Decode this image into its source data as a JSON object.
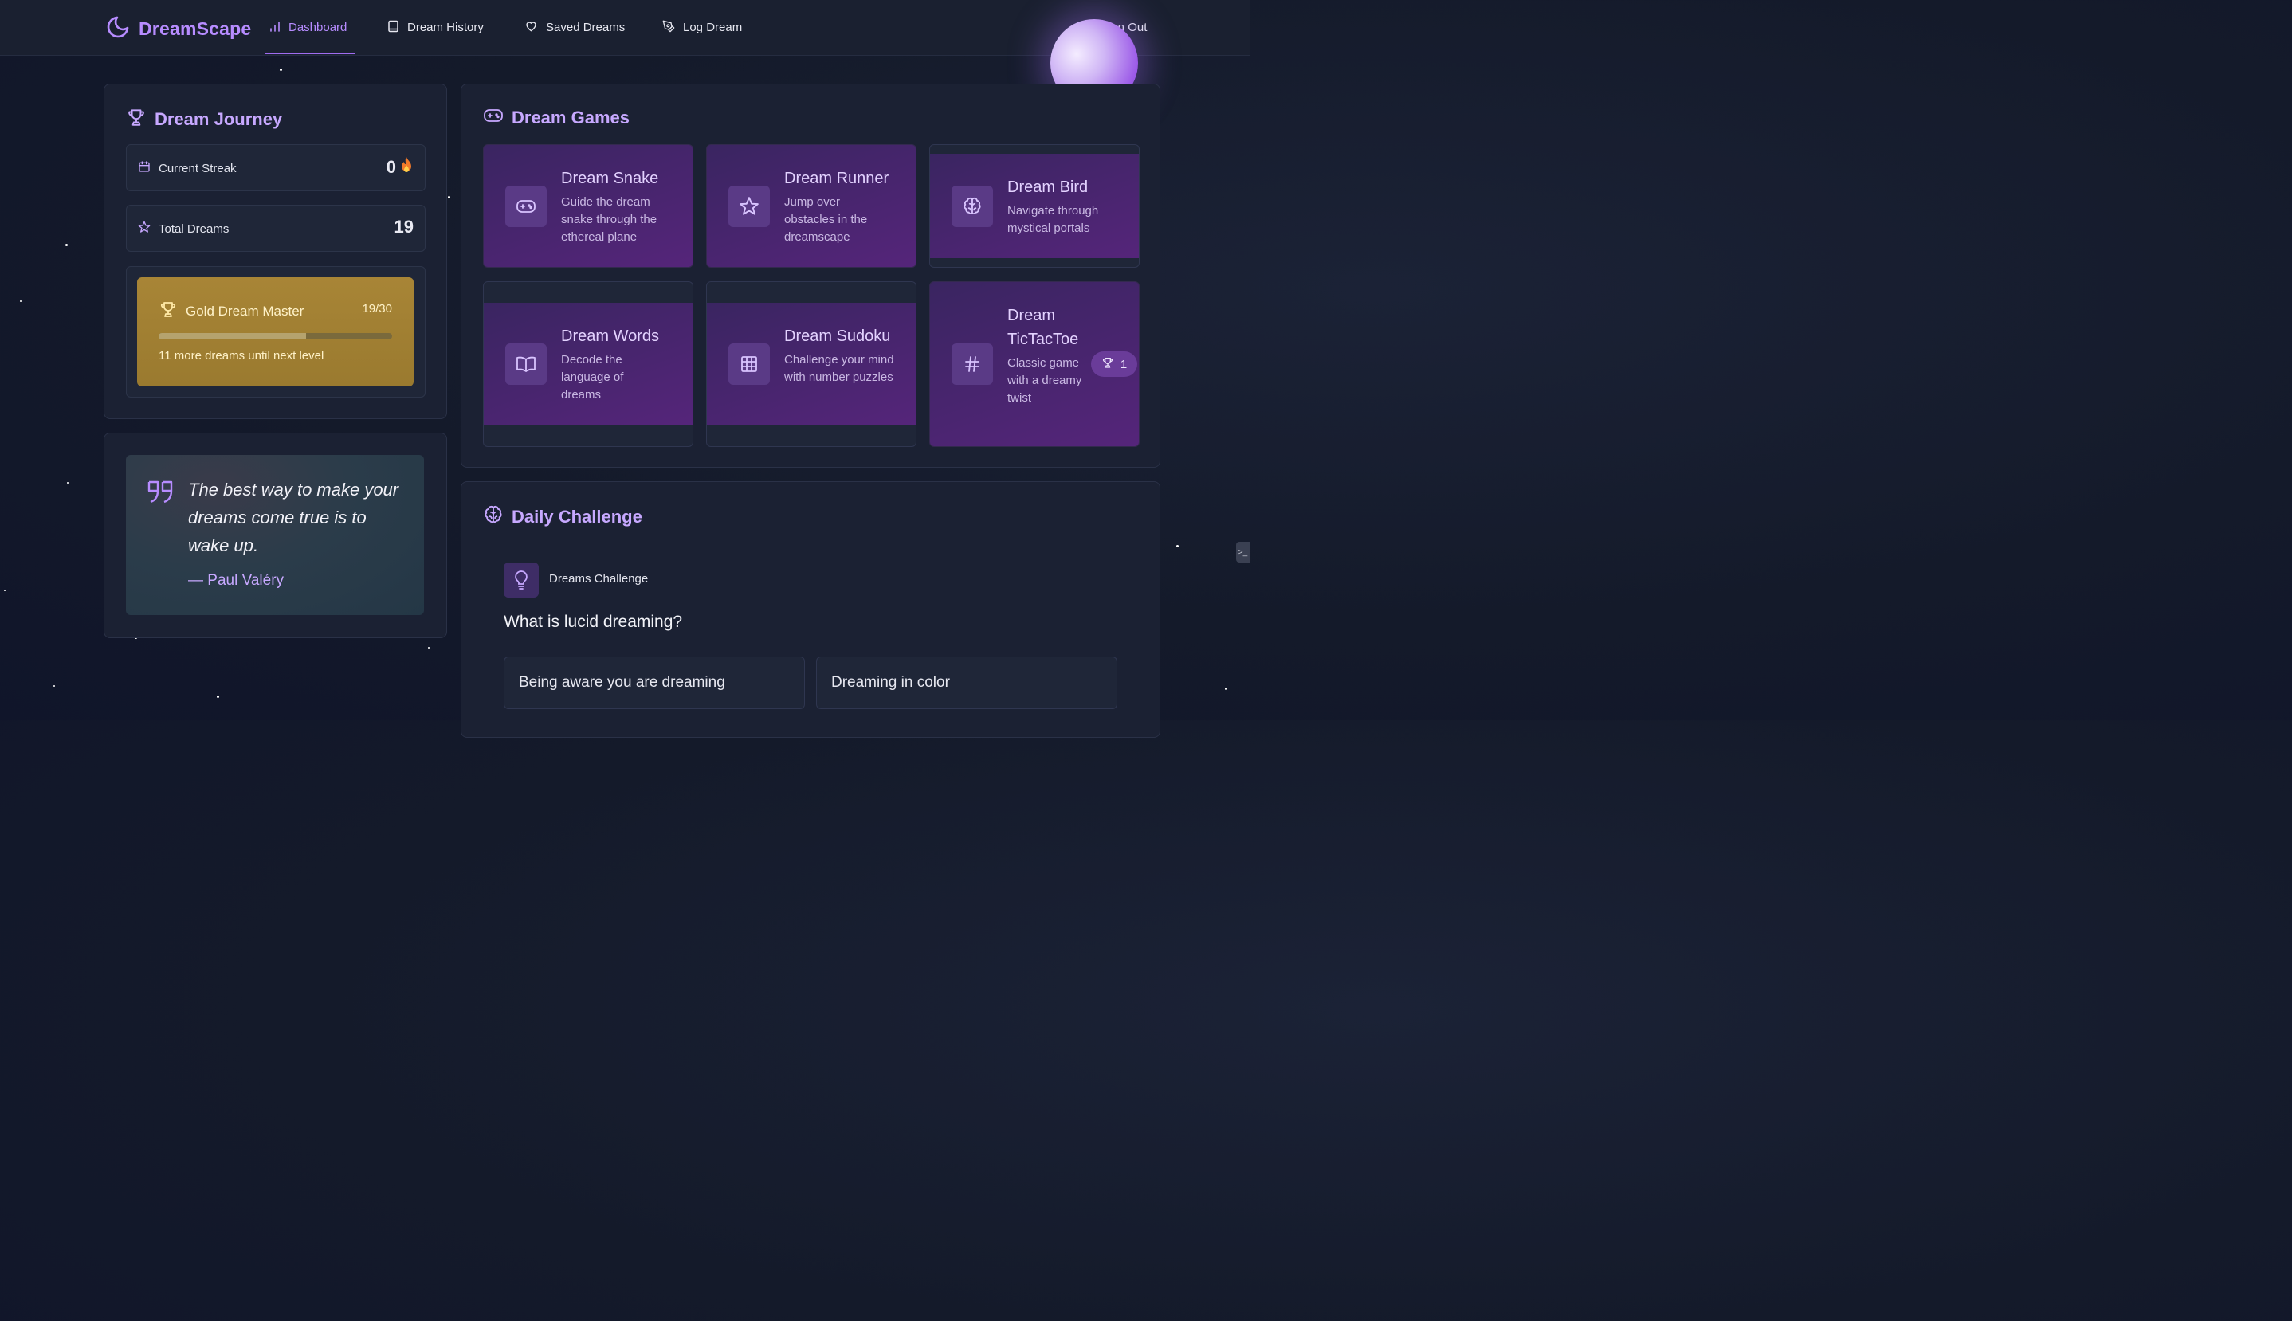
{
  "nav": {
    "brand": "DreamScape",
    "items": [
      {
        "label": "Dashboard",
        "icon": "bar-chart-icon",
        "active": true
      },
      {
        "label": "Dream History",
        "icon": "book-icon"
      },
      {
        "label": "Saved Dreams",
        "icon": "heart-icon"
      },
      {
        "label": "Log Dream",
        "icon": "pen-icon"
      }
    ],
    "sign_out": "Sign Out"
  },
  "journey": {
    "title": "Dream Journey",
    "streak_label": "Current Streak",
    "streak_value": "0",
    "total_label": "Total Dreams",
    "total_value": "19",
    "level": {
      "name": "Gold Dream Master",
      "count": "19/30",
      "progress": 0.633,
      "note": "11 more dreams until next level"
    }
  },
  "quote": {
    "text": "The best way to make your dreams come true is to wake up.",
    "author": "— Paul Valéry"
  },
  "games": {
    "title": "Dream Games",
    "items": [
      {
        "title": "Dream Snake",
        "desc": "Guide the dream snake through the ethereal plane",
        "icon": "gamepad-icon"
      },
      {
        "title": "Dream Runner",
        "desc": "Jump over obstacles in the dreamscape",
        "icon": "star-icon"
      },
      {
        "title": "Dream Bird",
        "desc": "Navigate through mystical portals",
        "icon": "brain-icon"
      },
      {
        "title": "Dream Words",
        "desc": "Decode the language of dreams",
        "icon": "open-book-icon"
      },
      {
        "title": "Dream Sudoku",
        "desc": "Challenge your mind with number puzzles",
        "icon": "grid-icon"
      },
      {
        "title": "Dream TicTacToe",
        "desc": "Classic game with a dreamy twist",
        "icon": "hash-icon",
        "badge": "1"
      }
    ]
  },
  "challenge": {
    "title": "Daily Challenge",
    "label": "Dreams Challenge",
    "question": "What is lucid dreaming?",
    "options": [
      "Being aware you are dreaming",
      "Dreaming in color"
    ]
  },
  "colors": {
    "accent": "#b78cff",
    "gold": "#a88536",
    "game_bg": "#4a2570"
  }
}
